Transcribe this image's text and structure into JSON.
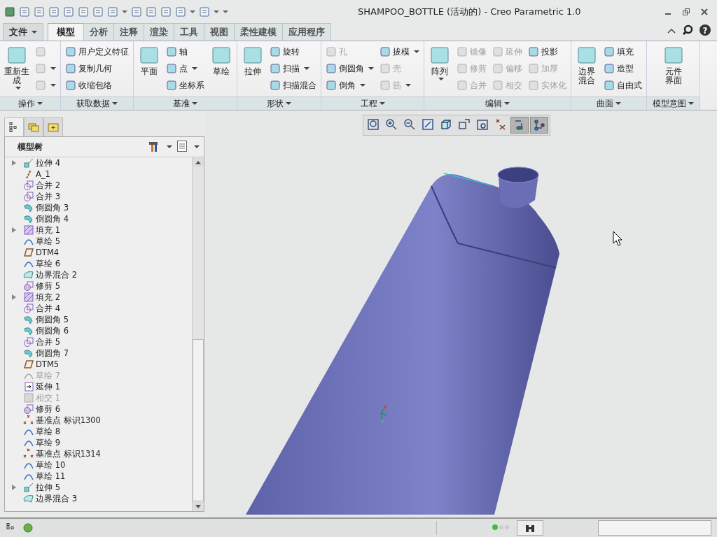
{
  "window": {
    "title": "SHAMPOO_BOTTLE (活动的) - Creo Parametric 1.0"
  },
  "help_button": "?",
  "ribbon_tabs": [
    {
      "label": "文件",
      "kind": "menu",
      "selected": false
    },
    {
      "label": "模型",
      "kind": "tab",
      "selected": true
    },
    {
      "label": "分析",
      "kind": "tab",
      "selected": false
    },
    {
      "label": "注释",
      "kind": "tab",
      "selected": false
    },
    {
      "label": "渲染",
      "kind": "tab",
      "selected": false
    },
    {
      "label": "工具",
      "kind": "tab",
      "selected": false
    },
    {
      "label": "视图",
      "kind": "tab",
      "selected": false
    },
    {
      "label": "柔性建模",
      "kind": "tab",
      "selected": false
    },
    {
      "label": "应用程序",
      "kind": "tab",
      "selected": false
    }
  ],
  "ribbon_groups": [
    {
      "label": "操作",
      "items": [
        {
          "label": [
            "重新生",
            "成"
          ],
          "kind": "large",
          "dropdown": true,
          "disabled": false
        },
        {
          "kind": "small",
          "dropdown": false,
          "disabled": true
        },
        {
          "kind": "small",
          "dropdown": true,
          "disabled": true
        },
        {
          "kind": "small",
          "dropdown": true,
          "disabled": true
        }
      ]
    },
    {
      "label": "获取数据",
      "items": [
        {
          "label": "用户定义特征",
          "kind": "small",
          "dropdown": false,
          "disabled": false
        },
        {
          "label": "复制几何",
          "kind": "small",
          "dropdown": false,
          "disabled": false
        },
        {
          "label": "收缩包络",
          "kind": "small",
          "dropdown": false,
          "disabled": false
        }
      ]
    },
    {
      "label": "基准",
      "items": [
        {
          "label": [
            "平面"
          ],
          "kind": "large",
          "dropdown": false,
          "disabled": false
        },
        {
          "label": "轴",
          "kind": "small",
          "dropdown": false,
          "disabled": false
        },
        {
          "label": "点",
          "kind": "small",
          "dropdown": true,
          "disabled": false
        },
        {
          "label": "坐标系",
          "kind": "small",
          "dropdown": false,
          "disabled": false
        },
        {
          "label": [
            "草绘"
          ],
          "kind": "large",
          "dropdown": false,
          "disabled": false
        }
      ]
    },
    {
      "label": "形状",
      "items": [
        {
          "label": [
            "拉伸"
          ],
          "kind": "large",
          "dropdown": false,
          "disabled": false
        },
        {
          "label": "旋转",
          "kind": "small",
          "dropdown": false,
          "disabled": false
        },
        {
          "label": "扫描",
          "kind": "small",
          "dropdown": true,
          "disabled": false
        },
        {
          "label": "扫描混合",
          "kind": "small",
          "dropdown": false,
          "disabled": false
        }
      ]
    },
    {
      "label": "工程",
      "items": [
        {
          "label": "孔",
          "kind": "small",
          "dropdown": false,
          "disabled": true
        },
        {
          "label": "倒圆角",
          "kind": "small",
          "dropdown": true,
          "disabled": false
        },
        {
          "label": "倒角",
          "kind": "small",
          "dropdown": true,
          "disabled": false
        },
        {
          "label": "拔模",
          "kind": "small",
          "dropdown": true,
          "disabled": false
        },
        {
          "label": "壳",
          "kind": "small",
          "dropdown": false,
          "disabled": true
        },
        {
          "label": "筋",
          "kind": "small",
          "dropdown": true,
          "disabled": true
        }
      ]
    },
    {
      "label": "编辑",
      "items": [
        {
          "label": [
            "阵列"
          ],
          "kind": "large",
          "dropdown": true,
          "disabled": false
        },
        {
          "label": "镜像",
          "kind": "small",
          "dropdown": false,
          "disabled": true
        },
        {
          "label": "修剪",
          "kind": "small",
          "dropdown": false,
          "disabled": true
        },
        {
          "label": "合并",
          "kind": "small",
          "dropdown": false,
          "disabled": true
        },
        {
          "label": "延伸",
          "kind": "small",
          "dropdown": false,
          "disabled": true
        },
        {
          "label": "偏移",
          "kind": "small",
          "dropdown": false,
          "disabled": true
        },
        {
          "label": "相交",
          "kind": "small",
          "dropdown": false,
          "disabled": true
        },
        {
          "label": "投影",
          "kind": "small",
          "dropdown": false,
          "disabled": false
        },
        {
          "label": "加厚",
          "kind": "small",
          "dropdown": false,
          "disabled": true
        },
        {
          "label": "实体化",
          "kind": "small",
          "dropdown": false,
          "disabled": true
        }
      ]
    },
    {
      "label": "曲面",
      "items": [
        {
          "label": [
            "边界",
            "混合"
          ],
          "kind": "large",
          "dropdown": false,
          "disabled": false
        },
        {
          "label": "填充",
          "kind": "small",
          "dropdown": false,
          "disabled": false
        },
        {
          "label": "造型",
          "kind": "small",
          "dropdown": false,
          "disabled": false
        },
        {
          "label": "自由式",
          "kind": "small",
          "dropdown": false,
          "disabled": false
        }
      ]
    },
    {
      "label": "模型意图",
      "items": [
        {
          "label": [
            "元件",
            "界面"
          ],
          "kind": "large",
          "dropdown": false,
          "disabled": false
        }
      ]
    }
  ],
  "panel_tabs": [
    {
      "kind": "tree",
      "selected": true
    },
    {
      "kind": "folders",
      "selected": false
    },
    {
      "kind": "favorites",
      "selected": false
    }
  ],
  "model_tree": {
    "title": "模型树",
    "items": [
      {
        "label": "拉伸 4",
        "kind": "extrude",
        "expandable": true,
        "disabled": false
      },
      {
        "label": "A_1",
        "kind": "axis",
        "expandable": false,
        "disabled": false
      },
      {
        "label": "合并 2",
        "kind": "merge",
        "expandable": false,
        "disabled": false
      },
      {
        "label": "合并 3",
        "kind": "merge",
        "expandable": false,
        "disabled": false
      },
      {
        "label": "倒圆角 3",
        "kind": "round",
        "expandable": false,
        "disabled": false
      },
      {
        "label": "倒圆角 4",
        "kind": "round",
        "expandable": false,
        "disabled": false
      },
      {
        "label": "填充 1",
        "kind": "fill",
        "expandable": true,
        "disabled": false
      },
      {
        "label": "草绘 5",
        "kind": "sketch",
        "expandable": false,
        "disabled": false
      },
      {
        "label": "DTM4",
        "kind": "plane",
        "expandable": false,
        "disabled": false
      },
      {
        "label": "草绘 6",
        "kind": "sketch",
        "expandable": false,
        "disabled": false
      },
      {
        "label": "边界混合 2",
        "kind": "blend",
        "expandable": false,
        "disabled": false
      },
      {
        "label": "修剪 5",
        "kind": "trim",
        "expandable": false,
        "disabled": false
      },
      {
        "label": "填充 2",
        "kind": "fill",
        "expandable": true,
        "disabled": false
      },
      {
        "label": "合并 4",
        "kind": "merge",
        "expandable": false,
        "disabled": false
      },
      {
        "label": "倒圆角 5",
        "kind": "round",
        "expandable": false,
        "disabled": false
      },
      {
        "label": "倒圆角 6",
        "kind": "round",
        "expandable": false,
        "disabled": false
      },
      {
        "label": "合并 5",
        "kind": "merge",
        "expandable": false,
        "disabled": false
      },
      {
        "label": "倒圆角 7",
        "kind": "round",
        "expandable": false,
        "disabled": false
      },
      {
        "label": "DTM5",
        "kind": "plane",
        "expandable": false,
        "disabled": false
      },
      {
        "label": "草绘 7",
        "kind": "sketch",
        "expandable": false,
        "disabled": true
      },
      {
        "label": "延伸 1",
        "kind": "extend",
        "expandable": false,
        "disabled": false
      },
      {
        "label": "相交 1",
        "kind": "intersect",
        "expandable": false,
        "disabled": true
      },
      {
        "label": "修剪 6",
        "kind": "trim",
        "expandable": false,
        "disabled": false
      },
      {
        "label": "基准点 标识1300",
        "kind": "point",
        "expandable": false,
        "disabled": false
      },
      {
        "label": "草绘 8",
        "kind": "sketch",
        "expandable": false,
        "disabled": false
      },
      {
        "label": "草绘 9",
        "kind": "sketch",
        "expandable": false,
        "disabled": false
      },
      {
        "label": "基准点 标识1314",
        "kind": "point",
        "expandable": false,
        "disabled": false
      },
      {
        "label": "草绘 10",
        "kind": "sketch",
        "expandable": false,
        "disabled": false
      },
      {
        "label": "草绘 11",
        "kind": "sketch",
        "expandable": false,
        "disabled": false
      },
      {
        "label": "拉伸 5",
        "kind": "extrude",
        "expandable": true,
        "disabled": false
      },
      {
        "label": "边界混合 3",
        "kind": "blend",
        "expandable": false,
        "disabled": false
      }
    ]
  },
  "view_toolbar": [
    {
      "kind": "refit",
      "on": false
    },
    {
      "kind": "zoom-in",
      "on": false
    },
    {
      "kind": "zoom-out",
      "on": false
    },
    {
      "kind": "repaint",
      "on": false
    },
    {
      "kind": "display-style",
      "on": false
    },
    {
      "kind": "saved-views",
      "on": false
    },
    {
      "kind": "view-manager",
      "on": false
    },
    {
      "kind": "datum-display",
      "on": false
    },
    {
      "kind": "annotation-display",
      "on": true
    },
    {
      "kind": "spin-center",
      "on": true
    }
  ]
}
